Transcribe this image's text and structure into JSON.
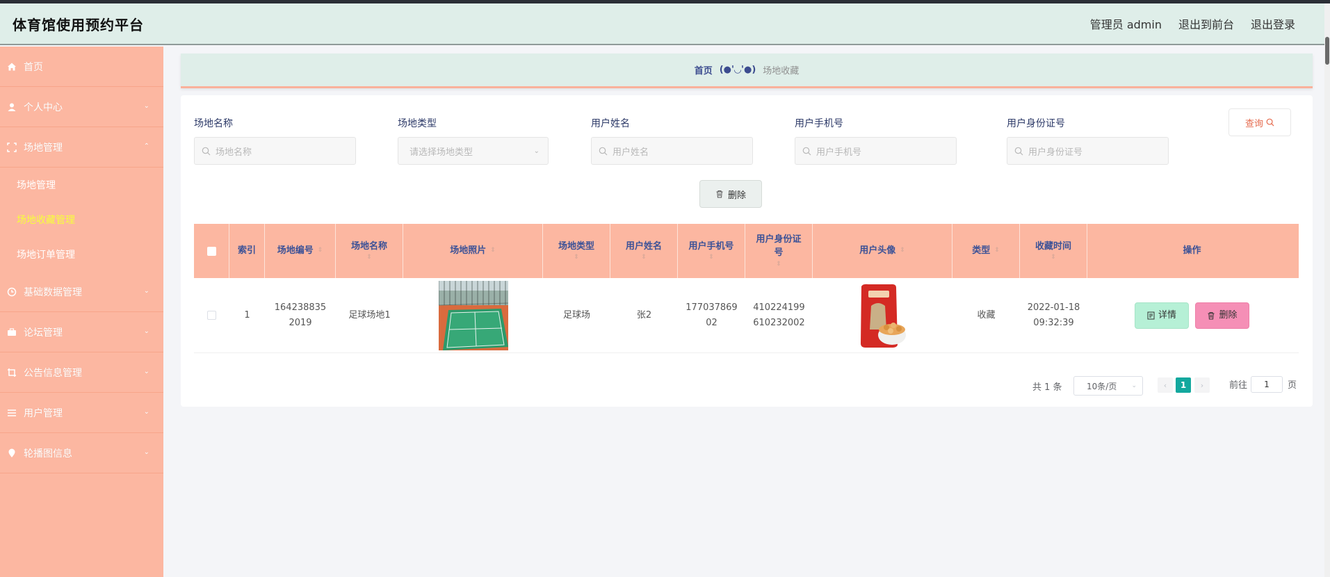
{
  "header": {
    "title": "体育馆使用预约平台",
    "user_label": "管理员 admin",
    "to_front": "退出到前台",
    "logout": "退出登录"
  },
  "sidebar": {
    "items": [
      {
        "label": "首页",
        "icon": "home-icon"
      },
      {
        "label": "个人中心",
        "icon": "user-icon"
      },
      {
        "label": "场地管理",
        "icon": "venue-icon"
      },
      {
        "label": "基础数据管理",
        "icon": "clock-icon"
      },
      {
        "label": "论坛管理",
        "icon": "forum-icon"
      },
      {
        "label": "公告信息管理",
        "icon": "notice-icon"
      },
      {
        "label": "用户管理",
        "icon": "list-icon"
      },
      {
        "label": "轮播图信息",
        "icon": "location-icon"
      }
    ],
    "submenu": [
      "场地管理",
      "场地收藏管理",
      "场地订单管理"
    ],
    "active_color": "#f6ff3a"
  },
  "breadcrumb": {
    "home": "首页",
    "face": "(●'◡'●)",
    "current": "场地收藏"
  },
  "filters": {
    "venue_name_label": "场地名称",
    "venue_name_placeholder": "场地名称",
    "venue_type_label": "场地类型",
    "venue_type_placeholder": "请选择场地类型",
    "user_name_label": "用户姓名",
    "user_name_placeholder": "用户姓名",
    "user_phone_label": "用户手机号",
    "user_phone_placeholder": "用户手机号",
    "user_id_label": "用户身份证号",
    "user_id_placeholder": "用户身份证号",
    "search_button": "查询"
  },
  "toolbar": {
    "delete_button": "删除"
  },
  "table": {
    "headers": {
      "index": "索引",
      "venue_code": "场地编号",
      "venue_name": "场地名称",
      "venue_photo": "场地照片",
      "venue_type": "场地类型",
      "user_name": "用户姓名",
      "user_phone": "用户手机号",
      "user_id": "用户身份证号",
      "user_avatar": "用户头像",
      "type": "类型",
      "fav_time": "收藏时间",
      "actions": "操作"
    },
    "rows": [
      {
        "index": "1",
        "venue_code": "1642388352019",
        "venue_name": "足球场地1",
        "venue_type": "足球场",
        "user_name": "张2",
        "user_phone": "17703786902",
        "user_id": "410224199610232002",
        "type": "收藏",
        "fav_time": "2022-01-18 09:32:39",
        "detail_button": "详情",
        "delete_button": "删除"
      }
    ],
    "header_color": "#fcb7a1",
    "header_text_color": "#3c5297"
  },
  "pagination": {
    "total": "共 1 条",
    "page_size": "10条/页",
    "current_page": "1",
    "goto_label": "前往",
    "goto_value": "1",
    "page_unit": "页"
  }
}
